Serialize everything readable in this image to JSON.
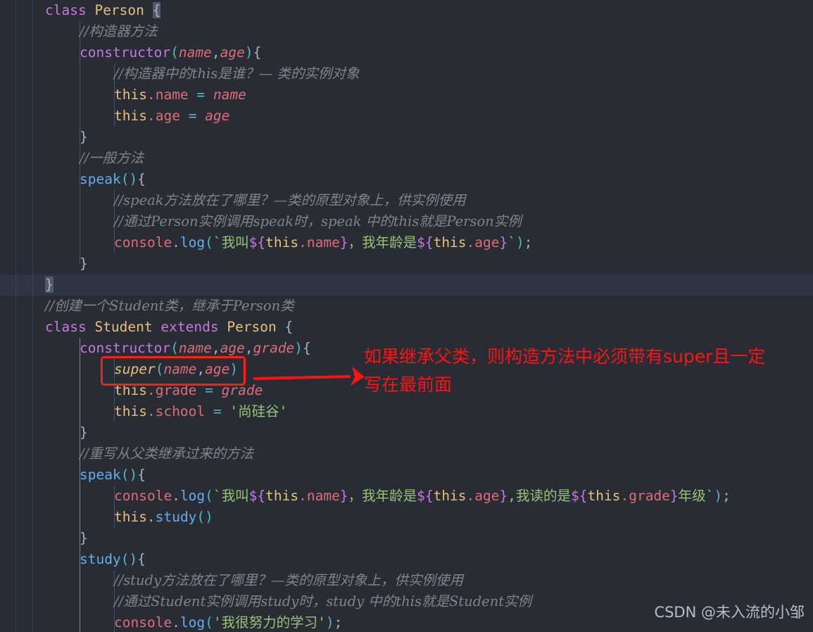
{
  "editor": {
    "theme_background": "#282c34",
    "active_line_background": "#2f3542",
    "font_size_px": 19.5,
    "line_height_px": 30
  },
  "colors": {
    "keyword": "#c678dd",
    "class_name": "#e5c07b",
    "method": "#61afef",
    "property": "#e06c75",
    "operator": "#56b6c2",
    "string": "#98c379",
    "comment": "#7f848e",
    "annotation_red": "#fd1313",
    "default_text": "#abb2bf"
  },
  "code_lines": [
    {
      "indent": 0,
      "segments": [
        {
          "t": "class",
          "c": "kw"
        },
        {
          "t": " ",
          "c": "punc"
        },
        {
          "t": "Person",
          "c": "cls"
        },
        {
          "t": " ",
          "c": "punc"
        },
        {
          "t": "{",
          "c": "punc bmatch"
        }
      ]
    },
    {
      "indent": 1,
      "segments": [
        {
          "t": "//构造器方法",
          "c": "cmt"
        }
      ]
    },
    {
      "indent": 1,
      "segments": [
        {
          "t": "constructor",
          "c": "fn"
        },
        {
          "t": "(",
          "c": "paren"
        },
        {
          "t": "name",
          "c": "param"
        },
        {
          "t": ",",
          "c": "punc"
        },
        {
          "t": "age",
          "c": "param"
        },
        {
          "t": ")",
          "c": "paren"
        },
        {
          "t": "{",
          "c": "punc"
        }
      ]
    },
    {
      "indent": 2,
      "segments": [
        {
          "t": "//构造器中的this是谁？— 类的实例对象",
          "c": "cmt"
        }
      ]
    },
    {
      "indent": 2,
      "segments": [
        {
          "t": "this",
          "c": "cls"
        },
        {
          "t": ".name",
          "c": "prop"
        },
        {
          "t": " ",
          "c": "punc"
        },
        {
          "t": "=",
          "c": "op"
        },
        {
          "t": " ",
          "c": "punc"
        },
        {
          "t": "name",
          "c": "param"
        }
      ]
    },
    {
      "indent": 2,
      "segments": [
        {
          "t": "this",
          "c": "cls"
        },
        {
          "t": ".age",
          "c": "prop"
        },
        {
          "t": " ",
          "c": "punc"
        },
        {
          "t": "=",
          "c": "op"
        },
        {
          "t": " ",
          "c": "punc"
        },
        {
          "t": "age",
          "c": "param"
        }
      ]
    },
    {
      "indent": 1,
      "segments": [
        {
          "t": "}",
          "c": "punc"
        }
      ]
    },
    {
      "indent": 1,
      "segments": [
        {
          "t": "//一般方法",
          "c": "cmt"
        }
      ]
    },
    {
      "indent": 1,
      "segments": [
        {
          "t": "speak",
          "c": "meth"
        },
        {
          "t": "()",
          "c": "paren"
        },
        {
          "t": "{",
          "c": "punc"
        }
      ]
    },
    {
      "indent": 2,
      "segments": [
        {
          "t": "//speak方法放在了哪里？—类的原型对象上，供实例使用",
          "c": "cmt"
        }
      ]
    },
    {
      "indent": 2,
      "segments": [
        {
          "t": "//通过Person实例调用speak时，speak 中的this就是Person实例",
          "c": "cmt"
        }
      ]
    },
    {
      "indent": 2,
      "segments": [
        {
          "t": "console",
          "c": "obj"
        },
        {
          "t": ".",
          "c": "punc"
        },
        {
          "t": "log",
          "c": "meth"
        },
        {
          "t": "(",
          "c": "paren"
        },
        {
          "t": "`我叫",
          "c": "tpl"
        },
        {
          "t": "${",
          "c": "subst"
        },
        {
          "t": "this",
          "c": "cls"
        },
        {
          "t": ".name",
          "c": "prop"
        },
        {
          "t": "}",
          "c": "subst"
        },
        {
          "t": "，我年龄是",
          "c": "tpl"
        },
        {
          "t": "${",
          "c": "subst"
        },
        {
          "t": "this",
          "c": "cls"
        },
        {
          "t": ".age",
          "c": "prop"
        },
        {
          "t": "}",
          "c": "subst"
        },
        {
          "t": "`",
          "c": "tpl"
        },
        {
          "t": ")",
          "c": "paren"
        },
        {
          "t": ";",
          "c": "punc"
        }
      ]
    },
    {
      "indent": 1,
      "segments": [
        {
          "t": "}",
          "c": "punc"
        }
      ]
    },
    {
      "indent": 0,
      "active": true,
      "segments": [
        {
          "t": "}",
          "c": "punc bmatch"
        }
      ]
    },
    {
      "indent": 0,
      "segments": [
        {
          "t": "//创建一个Student类，继承于Person类",
          "c": "cmt"
        }
      ]
    },
    {
      "indent": 0,
      "segments": [
        {
          "t": "class",
          "c": "kw"
        },
        {
          "t": " ",
          "c": "punc"
        },
        {
          "t": "Student",
          "c": "cls"
        },
        {
          "t": " ",
          "c": "punc"
        },
        {
          "t": "extends",
          "c": "kw"
        },
        {
          "t": " ",
          "c": "punc"
        },
        {
          "t": "Person",
          "c": "cls"
        },
        {
          "t": " ",
          "c": "punc"
        },
        {
          "t": "{",
          "c": "punc"
        }
      ]
    },
    {
      "indent": 1,
      "segments": [
        {
          "t": "constructor",
          "c": "fn"
        },
        {
          "t": "(",
          "c": "paren"
        },
        {
          "t": "name",
          "c": "param"
        },
        {
          "t": ",",
          "c": "punc"
        },
        {
          "t": "age",
          "c": "param"
        },
        {
          "t": ",",
          "c": "punc"
        },
        {
          "t": "grade",
          "c": "param"
        },
        {
          "t": ")",
          "c": "paren"
        },
        {
          "t": "{",
          "c": "punc"
        }
      ]
    },
    {
      "indent": 2,
      "segments": [
        {
          "t": "super",
          "c": "sup"
        },
        {
          "t": "(",
          "c": "paren"
        },
        {
          "t": "name",
          "c": "param"
        },
        {
          "t": ",",
          "c": "punc"
        },
        {
          "t": "age",
          "c": "param"
        },
        {
          "t": ")",
          "c": "paren"
        }
      ]
    },
    {
      "indent": 2,
      "segments": [
        {
          "t": "this",
          "c": "cls"
        },
        {
          "t": ".grade",
          "c": "prop"
        },
        {
          "t": " ",
          "c": "punc"
        },
        {
          "t": "=",
          "c": "op"
        },
        {
          "t": " ",
          "c": "punc"
        },
        {
          "t": "grade",
          "c": "param"
        }
      ]
    },
    {
      "indent": 2,
      "segments": [
        {
          "t": "this",
          "c": "cls"
        },
        {
          "t": ".school",
          "c": "prop"
        },
        {
          "t": " ",
          "c": "punc"
        },
        {
          "t": "=",
          "c": "op"
        },
        {
          "t": " ",
          "c": "punc"
        },
        {
          "t": "'尚硅谷'",
          "c": "str"
        }
      ]
    },
    {
      "indent": 1,
      "segments": [
        {
          "t": "}",
          "c": "punc"
        }
      ]
    },
    {
      "indent": 1,
      "segments": [
        {
          "t": "//重写从父类继承过来的方法",
          "c": "cmt"
        }
      ]
    },
    {
      "indent": 1,
      "segments": [
        {
          "t": "speak",
          "c": "meth"
        },
        {
          "t": "()",
          "c": "paren"
        },
        {
          "t": "{",
          "c": "punc"
        }
      ]
    },
    {
      "indent": 2,
      "segments": [
        {
          "t": "console",
          "c": "obj"
        },
        {
          "t": ".",
          "c": "punc"
        },
        {
          "t": "log",
          "c": "meth"
        },
        {
          "t": "(",
          "c": "paren"
        },
        {
          "t": "`我叫",
          "c": "tpl"
        },
        {
          "t": "${",
          "c": "subst"
        },
        {
          "t": "this",
          "c": "cls"
        },
        {
          "t": ".name",
          "c": "prop"
        },
        {
          "t": "}",
          "c": "subst"
        },
        {
          "t": "，我年龄是",
          "c": "tpl"
        },
        {
          "t": "${",
          "c": "subst"
        },
        {
          "t": "this",
          "c": "cls"
        },
        {
          "t": ".age",
          "c": "prop"
        },
        {
          "t": "}",
          "c": "subst"
        },
        {
          "t": ",我读的是",
          "c": "tpl"
        },
        {
          "t": "${",
          "c": "subst"
        },
        {
          "t": "this",
          "c": "cls"
        },
        {
          "t": ".grade",
          "c": "prop"
        },
        {
          "t": "}",
          "c": "subst"
        },
        {
          "t": "年级`",
          "c": "tpl"
        },
        {
          "t": ")",
          "c": "paren"
        },
        {
          "t": ";",
          "c": "punc"
        }
      ]
    },
    {
      "indent": 2,
      "segments": [
        {
          "t": "this",
          "c": "cls"
        },
        {
          "t": ".",
          "c": "punc"
        },
        {
          "t": "study",
          "c": "meth"
        },
        {
          "t": "()",
          "c": "paren"
        }
      ]
    },
    {
      "indent": 1,
      "segments": [
        {
          "t": "}",
          "c": "punc"
        }
      ]
    },
    {
      "indent": 1,
      "segments": [
        {
          "t": "study",
          "c": "meth"
        },
        {
          "t": "()",
          "c": "paren"
        },
        {
          "t": "{",
          "c": "punc"
        }
      ]
    },
    {
      "indent": 2,
      "segments": [
        {
          "t": "//study方法放在了哪里？—类的原型对象上，供实例使用",
          "c": "cmt"
        }
      ]
    },
    {
      "indent": 2,
      "segments": [
        {
          "t": "//通过Student实例调用study时，study 中的this就是Student实例",
          "c": "cmt"
        }
      ]
    },
    {
      "indent": 2,
      "segments": [
        {
          "t": "console",
          "c": "obj"
        },
        {
          "t": ".",
          "c": "punc"
        },
        {
          "t": "log",
          "c": "meth"
        },
        {
          "t": "(",
          "c": "paren"
        },
        {
          "t": "'我很努力的学习'",
          "c": "str"
        },
        {
          "t": ")",
          "c": "paren"
        },
        {
          "t": ";",
          "c": "punc"
        }
      ]
    }
  ],
  "annotation": {
    "highlight_target": "super(name,age)",
    "text_line_1": "如果继承父类，则构造方法中必须带有super且一定",
    "text_line_2": "写在最前面"
  },
  "watermark": {
    "text": "CSDN @未入流的小邹"
  }
}
